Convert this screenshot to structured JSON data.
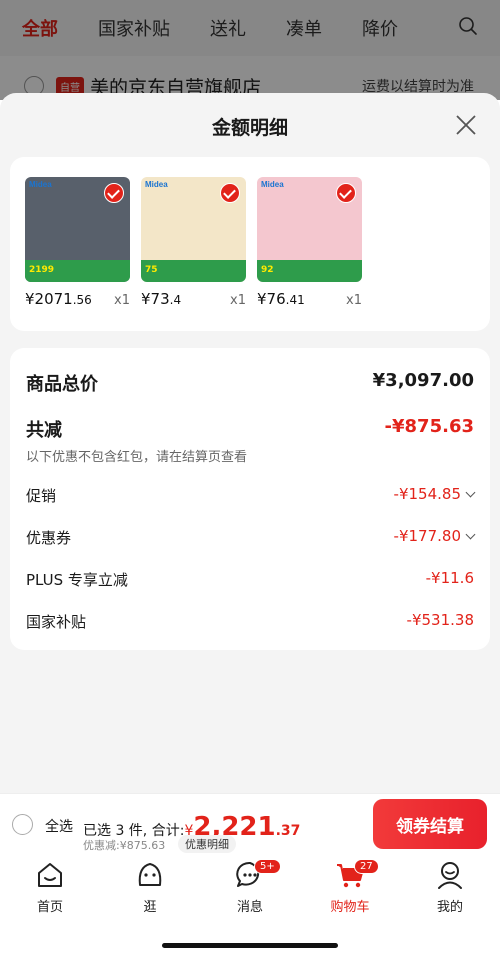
{
  "bg": {
    "tabs": [
      "全部",
      "国家补贴",
      "送礼",
      "凑单",
      "降价"
    ],
    "store_name": "美的京东自营旗舰店",
    "shipping": "运费以结算时为准"
  },
  "sheet": {
    "title": "金额明细",
    "products": [
      {
        "brand": "Midea",
        "price_int": "¥2071",
        "price_dec": ".56",
        "qty": "x1",
        "tag": "2199",
        "color": "#58606b"
      },
      {
        "brand": "Midea",
        "price_int": "¥73",
        "price_dec": ".4",
        "qty": "x1",
        "tag": "75",
        "color": "#f3e6c8"
      },
      {
        "brand": "Midea",
        "price_int": "¥76",
        "price_dec": ".41",
        "qty": "x1",
        "tag": "92",
        "color": "#f4c7cf"
      }
    ],
    "total_label": "商品总价",
    "total_value": "¥3,097.00",
    "reduce_label": "共减",
    "reduce_value": "-¥875.63",
    "note": "以下优惠不包含红包，请在结算页查看",
    "items": [
      {
        "label": "促销",
        "value": "-¥154.85"
      },
      {
        "label": "优惠券",
        "value": "-¥177.80"
      },
      {
        "label": "PLUS 专享立减",
        "value": "-¥11.6"
      },
      {
        "label": "国家补贴",
        "value": "-¥531.38"
      }
    ]
  },
  "bar": {
    "select_all": "全选",
    "summary_prefix": "已选 3 件, 合计:",
    "currency": "¥",
    "amount_int": "2,221",
    "amount_dec": ".37",
    "saved": "优惠减:¥875.63",
    "detail_chip": "优惠明细",
    "checkout": "领券结算"
  },
  "tabbar": {
    "items": [
      {
        "label": "首页",
        "icon": "home-icon"
      },
      {
        "label": "逛",
        "icon": "discover-icon"
      },
      {
        "label": "消息",
        "icon": "message-icon",
        "badge": "5+"
      },
      {
        "label": "购物车",
        "icon": "cart-icon",
        "badge": "27"
      },
      {
        "label": "我的",
        "icon": "profile-icon"
      }
    ]
  },
  "colors": {
    "accent": "#e2231a"
  }
}
